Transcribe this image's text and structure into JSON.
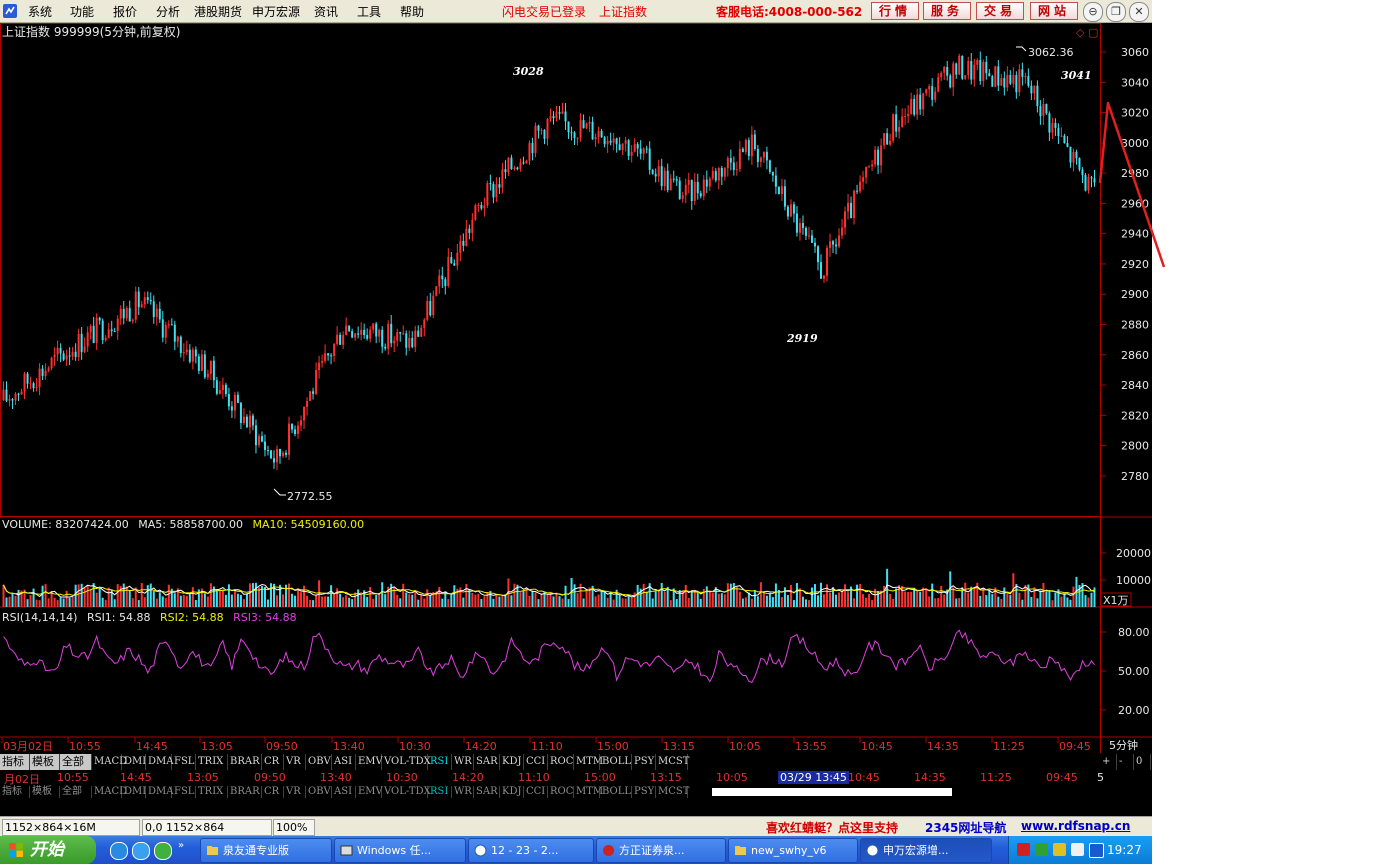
{
  "menubar": {
    "items": [
      "系统",
      "功能",
      "报价",
      "分析",
      "港股期货",
      "申万宏源",
      "资讯",
      "工具",
      "帮助"
    ],
    "status_login": "闪电交易已登录",
    "status_index": "上证指数",
    "hotline": "客服电话:4008-000-562",
    "quick_buttons": [
      "行情",
      "服务",
      "交易",
      "网站"
    ]
  },
  "chart": {
    "title": "上证指数 999999(5分钟,前复权)",
    "price_ticks": [
      "3060",
      "3040",
      "3020",
      "3000",
      "2980",
      "2960",
      "2940",
      "2920",
      "2900",
      "2880",
      "2860",
      "2840",
      "2820",
      "2800",
      "2780"
    ],
    "annotations": [
      "3028",
      "3041",
      "2919"
    ],
    "high_label": "3062.36",
    "low_label": "2772.55",
    "volume_header": {
      "main": "VOLUME: 83207424.00",
      "ma5": "MA5: 58858700.00",
      "ma10": "MA10: 54509160.00"
    },
    "volume_ticks": [
      "20000",
      "10000"
    ],
    "volume_unit": "X1万",
    "rsi_header": {
      "main": "RSI(14,14,14)",
      "rsi1": "RSI1: 54.88",
      "rsi2": "RSI2: 54.88",
      "rsi3": "RSI3: 54.88"
    },
    "rsi_ticks": [
      "80.00",
      "50.00",
      "20.00"
    ],
    "time_labels": [
      "03月02日",
      "10:55",
      "14:45",
      "13:05",
      "09:50",
      "13:40",
      "10:30",
      "14:20",
      "11:10",
      "15:00",
      "13:15",
      "10:05",
      "13:55",
      "10:45",
      "14:35",
      "11:25",
      "09:45"
    ],
    "period": "5分钟",
    "colors": {
      "up": "#ff3030",
      "down": "#40e0f0",
      "ma5": "#ffffff",
      "ma10": "#f0f000",
      "rsi": "#e040e0",
      "axis": "#b00000"
    }
  },
  "chart_data": {
    "type": "candlestick",
    "x": [
      "03月02日",
      "10:55",
      "14:45",
      "13:05",
      "09:50",
      "13:40",
      "10:30",
      "14:20",
      "11:10",
      "15:00",
      "13:15",
      "10:05",
      "13:55",
      "10:45",
      "14:35",
      "11:25",
      "09:45"
    ],
    "close": [
      2830,
      2865,
      2895,
      2850,
      2790,
      2880,
      2868,
      2960,
      3015,
      3005,
      2965,
      3000,
      2915,
      3010,
      3050,
      3040,
      2965
    ],
    "yrange": [
      2765,
      3070
    ],
    "high": 3062.36,
    "low": 2772.55,
    "annotations": [
      3028,
      3041,
      2919
    ],
    "volume_ticks": [
      20000,
      10000
    ],
    "rsi_ticks": [
      80,
      50,
      20
    ],
    "rsi_values": [
      78,
      62,
      55,
      60,
      52,
      48,
      70,
      62,
      60,
      74,
      58,
      56,
      66,
      60,
      48,
      68,
      72,
      52,
      66,
      58,
      50,
      72,
      54,
      76,
      63,
      50,
      48,
      62,
      55,
      54,
      80,
      70,
      58,
      52,
      56,
      50,
      62,
      58,
      55,
      54,
      66,
      48,
      52,
      60,
      44,
      58,
      64,
      48,
      56,
      74,
      60,
      56,
      68,
      74,
      68,
      54,
      50,
      62,
      70,
      46,
      60,
      58,
      54,
      60,
      52,
      50,
      58,
      52,
      40,
      66,
      52,
      50,
      44,
      58,
      60,
      56,
      76,
      72,
      62,
      52,
      58,
      50,
      44,
      68,
      70,
      63,
      54,
      58,
      70,
      52,
      58,
      64,
      80,
      72,
      62,
      62,
      60,
      55,
      66,
      58,
      52,
      63,
      50,
      44,
      58,
      55
    ],
    "last_rsi": 54.88
  },
  "bottom": {
    "tabs_row1": [
      "指标",
      "模板",
      "全部",
      "MACD",
      "DMI",
      "DMA",
      "FSL",
      "TRIX",
      "BRAR",
      "CR",
      "VR",
      "OBV",
      "ASI",
      "EMV",
      "VOL-TDX",
      "RSI",
      "WR",
      "SAR",
      "KDJ",
      "CCI",
      "ROC",
      "MTM",
      "BOLL",
      "PSY",
      "MCST"
    ],
    "tabs_row2": [
      "指标",
      "模板",
      "全部",
      "MACD",
      "DMI",
      "DMA",
      "FSL",
      "TRIX",
      "BRAR",
      "CR",
      "VR",
      "OBV",
      "ASI",
      "EMV",
      "VOL-TDX",
      "RSI",
      "WR",
      "SAR",
      "KDJ",
      "CCI",
      "ROC",
      "MTM",
      "BOLL",
      "PSY",
      "MCST"
    ],
    "dates_row": [
      "月02日",
      "10:55",
      "14:45",
      "13:05",
      "09:50",
      "13:40",
      "10:30",
      "14:20",
      "11:10",
      "15:00",
      "13:15",
      "10:05",
      "10:45",
      "14:35",
      "11:25",
      "09:45"
    ],
    "cursor_time": "03/29 13:45",
    "row_right": [
      "+",
      "-",
      "0"
    ],
    "row_right2": "5"
  },
  "status": {
    "resolution": "1152×864×16M",
    "coords": "0,0 1152×864",
    "zoom": "100%",
    "promo1": "喜欢红蜻蜓？点这里支持",
    "promo2": "2345网址导航",
    "promo3": "www.rdfsnap.cn"
  },
  "taskbar": {
    "start": "开始",
    "tasks": [
      "泉友通专业版",
      "Windows 任...",
      "12 - 23 - 2...",
      "方正证券泉...",
      "new_swhy_v6",
      "申万宏源增..."
    ],
    "clock": "19:27"
  }
}
